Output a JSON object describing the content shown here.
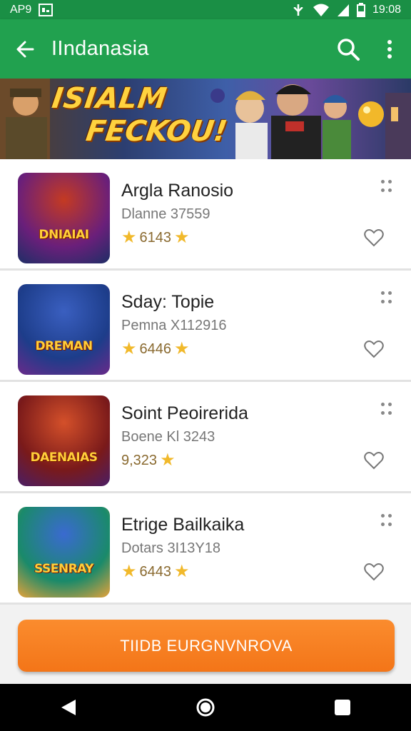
{
  "status_bar": {
    "left_text": "AP9",
    "time": "19:08"
  },
  "app_bar": {
    "title": "IIndanasia"
  },
  "banner": {
    "line1": "ISIALM",
    "line2": "FECKOU!"
  },
  "items": [
    {
      "title": "Argla Ranosio",
      "subtitle": "Dlanne 37559",
      "rating": "6143",
      "thumb_label": "DNIAIAI",
      "colors": [
        "#6a1f7a",
        "#c43a22",
        "#1e2e66"
      ]
    },
    {
      "title": "Sday: Topie",
      "subtitle": "Pemna X112916",
      "rating": "6446",
      "thumb_label": "DREMAN",
      "colors": [
        "#1d3d8a",
        "#3a5fc0",
        "#6a2a8a"
      ]
    },
    {
      "title": "Soint Peoirerida",
      "subtitle": "Boene Kl 3243",
      "rating": "9,323",
      "thumb_label": "DAENAIAS",
      "colors": [
        "#7a1a1a",
        "#d4502a",
        "#4a1e66"
      ]
    },
    {
      "title": "Etrige Bailkaika",
      "subtitle": "Dotars 3I13Y18",
      "rating": "6443",
      "thumb_label": "SSENRAY",
      "colors": [
        "#1a8a6a",
        "#3a6ad0",
        "#e6a23a"
      ]
    }
  ],
  "cta": {
    "label": "TIIDB EURGNVNROVA"
  },
  "colors": {
    "app_bar": "#21a14f",
    "status_bar": "#1a8f45",
    "cta": "#f37518",
    "star": "#f1b92b"
  },
  "icons": [
    "back-arrow-icon",
    "search-icon",
    "more-vert-icon",
    "drag-handle-icon",
    "heart-outline-icon",
    "star-icon",
    "nav-back-icon",
    "nav-home-icon",
    "nav-recents-icon"
  ]
}
